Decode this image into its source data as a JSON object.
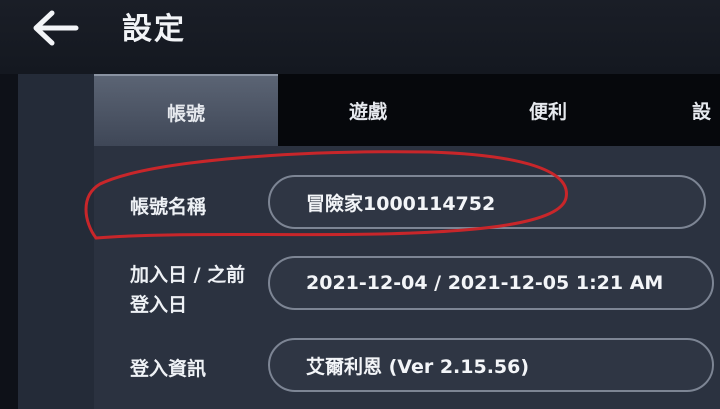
{
  "header": {
    "title": "設定"
  },
  "tabs": [
    {
      "label": "帳號"
    },
    {
      "label": "遊戲"
    },
    {
      "label": "便利"
    },
    {
      "label": "設"
    }
  ],
  "rows": [
    {
      "label": "帳號名稱",
      "value": "冒險家1000114752"
    },
    {
      "label_line1": "加入日 / 之前",
      "label_line2": "登入日",
      "value": "2021-12-04 / 2021-12-05  1:21 AM"
    },
    {
      "label": "登入資訊",
      "value": "艾爾利恩 (Ver 2.15.56)"
    }
  ],
  "colors": {
    "highlight_circle": "#c8262a",
    "active_tab": "#4d5666"
  }
}
